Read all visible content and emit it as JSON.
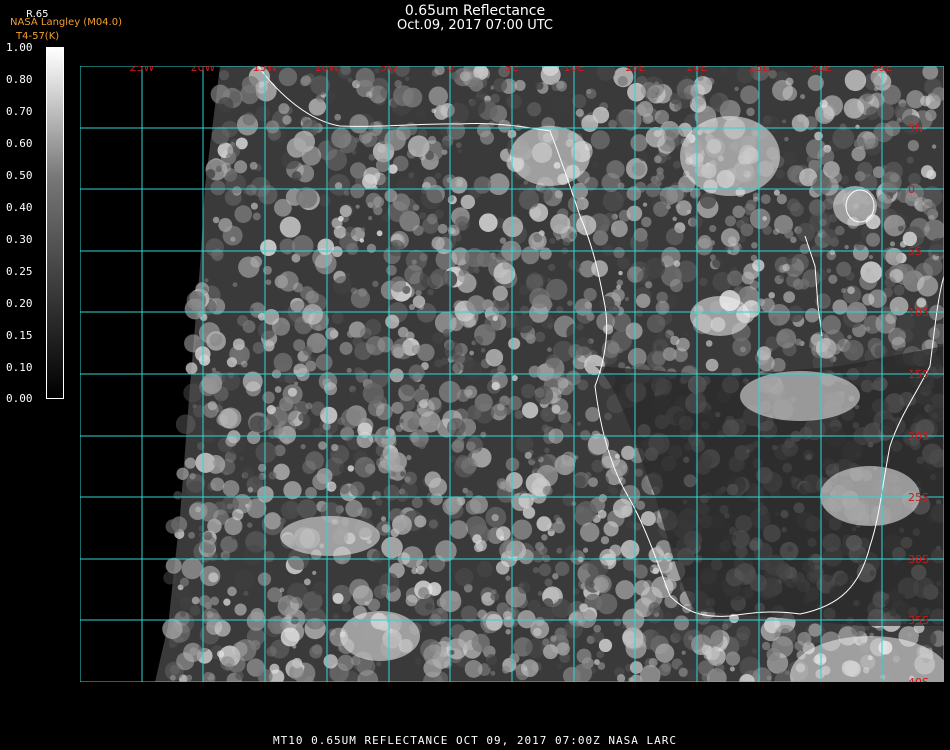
{
  "header": {
    "title": "0.65um Reflectance",
    "datetime": "Oct.09, 2017 07:00 UTC",
    "institution": "NASA Langley (M04.0)",
    "channel": "R.65",
    "sub_label": "T4-57(K)"
  },
  "colorbar": {
    "labels": [
      "1.00",
      "0.80",
      "0.70",
      "0.60",
      "0.50",
      "0.40",
      "0.30",
      "0.25",
      "0.20",
      "0.15",
      "0.10",
      "0.00"
    ]
  },
  "map": {
    "lon_labels": [
      "25W",
      "20W",
      "15W",
      "10W",
      "5W",
      "0",
      "5E",
      "10E",
      "15E",
      "20E",
      "25E",
      "30E",
      "35E"
    ],
    "lat_labels": [
      "5N",
      "0",
      "5S",
      "10S",
      "15S",
      "20S",
      "25S",
      "30S",
      "35S",
      "40S"
    ],
    "colors": {
      "grid": "#2fd6d6",
      "label": "#cc1a1a",
      "coast": "#ffffff"
    }
  },
  "footer": "MT10  0.65UM REFLECTANCE   OCT 09, 2017 07:00Z   NASA LARC"
}
